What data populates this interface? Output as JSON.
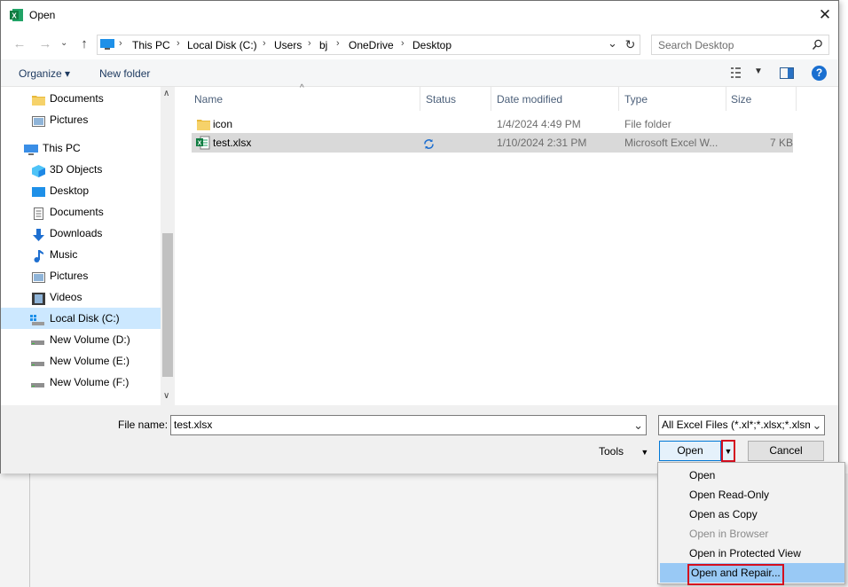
{
  "window": {
    "title": "Open",
    "close_glyph": "✕"
  },
  "nav": {
    "back": "←",
    "forward": "→",
    "up": "↑"
  },
  "address": {
    "crumbs": [
      "This PC",
      "Local Disk (C:)",
      "Users",
      "bj",
      "OneDrive",
      "Desktop"
    ],
    "separator": "›",
    "dropdown": "⌄",
    "refresh": "↻"
  },
  "search": {
    "placeholder": "Search Desktop"
  },
  "toolbar": {
    "organize": "Organize ▾",
    "new_folder": "New folder",
    "help": "?"
  },
  "sidebar": {
    "items": [
      {
        "label": "Documents",
        "icon": "documents-folder-icon"
      },
      {
        "label": "Pictures",
        "icon": "pictures-folder-icon"
      },
      {
        "label": "This PC",
        "icon": "computer-icon"
      },
      {
        "label": "3D Objects",
        "icon": "3d-objects-icon"
      },
      {
        "label": "Desktop",
        "icon": "desktop-icon"
      },
      {
        "label": "Documents",
        "icon": "documents-icon"
      },
      {
        "label": "Downloads",
        "icon": "downloads-icon"
      },
      {
        "label": "Music",
        "icon": "music-icon"
      },
      {
        "label": "Pictures",
        "icon": "pictures-icon"
      },
      {
        "label": "Videos",
        "icon": "videos-icon"
      },
      {
        "label": "Local Disk (C:)",
        "icon": "local-disk-icon"
      },
      {
        "label": "New Volume (D:)",
        "icon": "drive-icon"
      },
      {
        "label": "New Volume (E:)",
        "icon": "drive-icon"
      },
      {
        "label": "New Volume (F:)",
        "icon": "drive-icon"
      }
    ],
    "selected": "Local Disk (C:)"
  },
  "columns": [
    "Name",
    "Status",
    "Date modified",
    "Type",
    "Size"
  ],
  "files": [
    {
      "name": "icon",
      "status": "",
      "date": "1/4/2024 4:49 PM",
      "type": "File folder",
      "size": "",
      "icon": "folder-icon"
    },
    {
      "name": "test.xlsx",
      "status": "sync",
      "date": "1/10/2024 2:31 PM",
      "type": "Microsoft Excel W...",
      "size": "7 KB",
      "icon": "excel-file-icon",
      "selected": true
    }
  ],
  "bottom": {
    "file_name_label": "File name:",
    "file_name_value": "test.xlsx",
    "filter": "All Excel Files (*.xl*;*.xlsx;*.xlsm",
    "tools": "Tools",
    "open": "Open",
    "cancel": "Cancel"
  },
  "open_menu": {
    "items": [
      "Open",
      "Open Read-Only",
      "Open as Copy",
      "Open in Browser",
      "Open in Protected View",
      "Open and Repair..."
    ],
    "disabled": [
      "Open in Browser"
    ],
    "highlighted": "Open and Repair..."
  },
  "colors": {
    "accent": "#0078d7",
    "highlight_red": "#d40f1f",
    "selection": "#d9d9d9",
    "menu_highlight": "#99c9f5"
  }
}
